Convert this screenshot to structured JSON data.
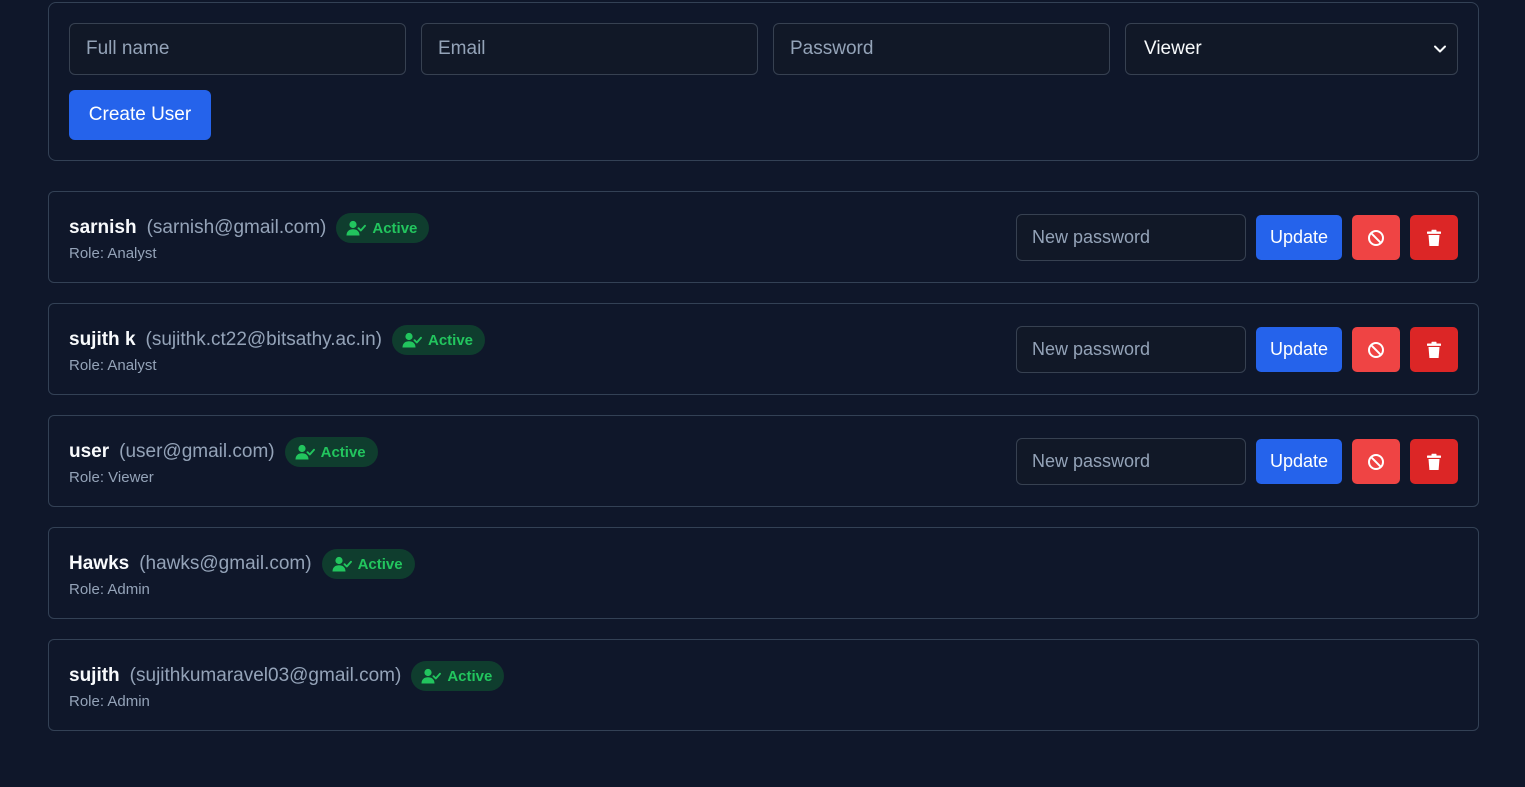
{
  "create_form": {
    "full_name_placeholder": "Full name",
    "email_placeholder": "Email",
    "password_placeholder": "Password",
    "role_selected": "Viewer",
    "create_button": "Create User"
  },
  "users": [
    {
      "name": "sarnish",
      "email": "(sarnish@gmail.com)",
      "status": "Active",
      "role": "Role: Analyst",
      "password_placeholder": "New password",
      "update_label": "Update"
    },
    {
      "name": "sujith k",
      "email": "(sujithk.ct22@bitsathy.ac.in)",
      "status": "Active",
      "role": "Role: Analyst",
      "password_placeholder": "New password",
      "update_label": "Update"
    },
    {
      "name": "user",
      "email": "(user@gmail.com)",
      "status": "Active",
      "role": "Role: Viewer",
      "password_placeholder": "New password",
      "update_label": "Update"
    },
    {
      "name": "Hawks",
      "email": "(hawks@gmail.com)",
      "status": "Active",
      "role": "Role: Admin"
    },
    {
      "name": "sujith",
      "email": "(sujithkumaravel03@gmail.com)",
      "status": "Active",
      "role": "Role: Admin"
    }
  ],
  "icons": {
    "status": "user-check-icon",
    "ban": "ban-icon",
    "delete": "trash-icon",
    "select": "chevron-down-icon"
  },
  "colors": {
    "background": "#0f172a",
    "primary": "#2563eb",
    "danger": "#ef4444",
    "danger_dark": "#dc2626",
    "success": "#22c55e"
  }
}
